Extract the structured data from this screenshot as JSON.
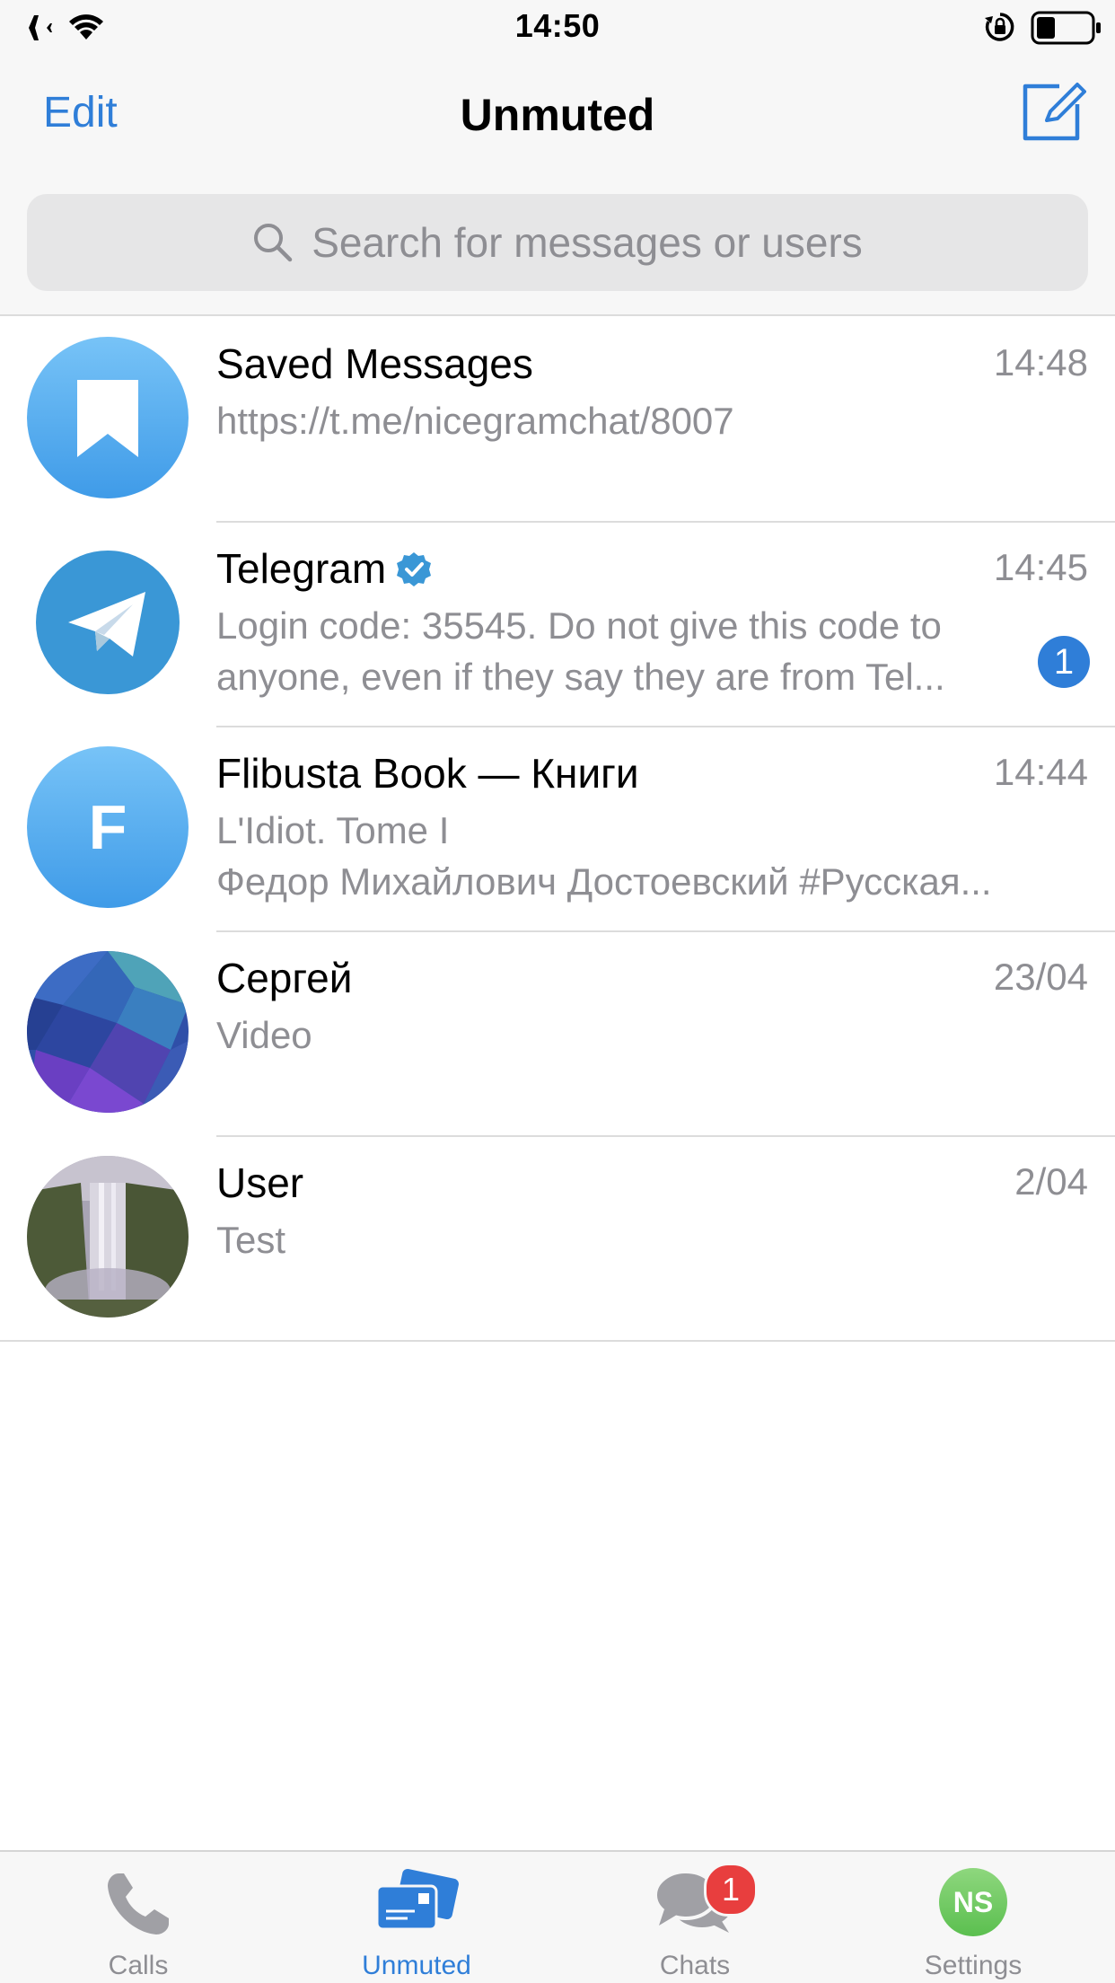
{
  "status_bar": {
    "time": "14:50",
    "icons": [
      "airplane-icon",
      "wifi-icon",
      "rotation-lock-icon",
      "battery-icon"
    ]
  },
  "nav": {
    "edit_label": "Edit",
    "title": "Unmuted",
    "compose_icon": "compose-icon"
  },
  "search": {
    "placeholder": "Search for messages or users"
  },
  "colors": {
    "accent": "#2f7ed8",
    "badge_red": "#e83e3e",
    "secondary_text": "#8e8e93"
  },
  "chats": [
    {
      "name": "Saved Messages",
      "time": "14:48",
      "preview": [
        "https://t.me/nicegramchat/8007"
      ],
      "avatar": "bookmark-icon"
    },
    {
      "name": "Telegram",
      "verified": true,
      "time": "14:45",
      "preview": [
        "Login code: 35545. Do not give this code to",
        "anyone, even if they say they are from Tel..."
      ],
      "unread": "1",
      "avatar": "telegram-plane-icon"
    },
    {
      "name": "Flibusta Book — Книги",
      "time": "14:44",
      "preview": [
        "L'Idiot. Tome I",
        "Федор Михайлович Достоевский  #Русская..."
      ],
      "avatar_letter": "F"
    },
    {
      "name": "Сергей",
      "time": "23/04",
      "preview": [
        "Video"
      ],
      "avatar": "photo-avatar-blue"
    },
    {
      "name": "User",
      "time": "2/04",
      "preview": [
        "Test"
      ],
      "avatar": "photo-avatar-waterfall"
    }
  ],
  "tabs": [
    {
      "label": "Calls",
      "icon": "phone-icon"
    },
    {
      "label": "Unmuted",
      "icon": "cards-icon",
      "active": true
    },
    {
      "label": "Chats",
      "icon": "chat-bubbles-icon",
      "badge": "1"
    },
    {
      "label": "Settings",
      "icon": "profile-avatar",
      "avatar_initials": "NS"
    }
  ]
}
